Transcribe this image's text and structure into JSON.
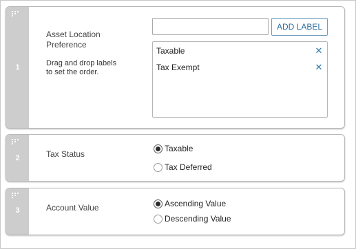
{
  "sections": [
    {
      "number": "1",
      "title": "Asset Location Preference",
      "hint": "Drag and drop labels to set the order.",
      "input_value": "",
      "add_button_label": "ADD LABEL",
      "labels": [
        {
          "text": "Taxable",
          "remove_glyph": "✕"
        },
        {
          "text": "Tax Exempt",
          "remove_glyph": "✕"
        }
      ]
    },
    {
      "number": "2",
      "title": "Tax Status",
      "options": [
        {
          "text": "Taxable",
          "selected": true
        },
        {
          "text": "Tax Deferred",
          "selected": false
        }
      ]
    },
    {
      "number": "3",
      "title": "Account Value",
      "options": [
        {
          "text": "Ascending Value",
          "selected": true
        },
        {
          "text": "Descending Value",
          "selected": false
        }
      ]
    }
  ],
  "icons": {
    "grip": "drag-handle-icon",
    "remove": "close-icon"
  },
  "colors": {
    "handle_bg": "#cdcdcd",
    "accent_blue": "#2a7ab0",
    "button_border": "#6d9dc0"
  }
}
